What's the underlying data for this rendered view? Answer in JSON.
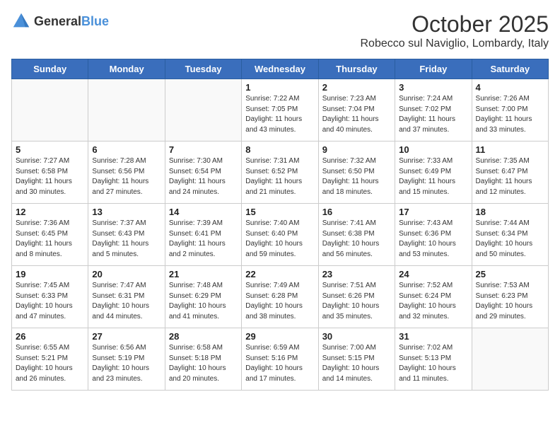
{
  "header": {
    "logo_general": "General",
    "logo_blue": "Blue",
    "month": "October 2025",
    "location": "Robecco sul Naviglio, Lombardy, Italy"
  },
  "days_of_week": [
    "Sunday",
    "Monday",
    "Tuesday",
    "Wednesday",
    "Thursday",
    "Friday",
    "Saturday"
  ],
  "weeks": [
    [
      {
        "day": "",
        "info": ""
      },
      {
        "day": "",
        "info": ""
      },
      {
        "day": "",
        "info": ""
      },
      {
        "day": "1",
        "info": "Sunrise: 7:22 AM\nSunset: 7:05 PM\nDaylight: 11 hours\nand 43 minutes."
      },
      {
        "day": "2",
        "info": "Sunrise: 7:23 AM\nSunset: 7:04 PM\nDaylight: 11 hours\nand 40 minutes."
      },
      {
        "day": "3",
        "info": "Sunrise: 7:24 AM\nSunset: 7:02 PM\nDaylight: 11 hours\nand 37 minutes."
      },
      {
        "day": "4",
        "info": "Sunrise: 7:26 AM\nSunset: 7:00 PM\nDaylight: 11 hours\nand 33 minutes."
      }
    ],
    [
      {
        "day": "5",
        "info": "Sunrise: 7:27 AM\nSunset: 6:58 PM\nDaylight: 11 hours\nand 30 minutes."
      },
      {
        "day": "6",
        "info": "Sunrise: 7:28 AM\nSunset: 6:56 PM\nDaylight: 11 hours\nand 27 minutes."
      },
      {
        "day": "7",
        "info": "Sunrise: 7:30 AM\nSunset: 6:54 PM\nDaylight: 11 hours\nand 24 minutes."
      },
      {
        "day": "8",
        "info": "Sunrise: 7:31 AM\nSunset: 6:52 PM\nDaylight: 11 hours\nand 21 minutes."
      },
      {
        "day": "9",
        "info": "Sunrise: 7:32 AM\nSunset: 6:50 PM\nDaylight: 11 hours\nand 18 minutes."
      },
      {
        "day": "10",
        "info": "Sunrise: 7:33 AM\nSunset: 6:49 PM\nDaylight: 11 hours\nand 15 minutes."
      },
      {
        "day": "11",
        "info": "Sunrise: 7:35 AM\nSunset: 6:47 PM\nDaylight: 11 hours\nand 12 minutes."
      }
    ],
    [
      {
        "day": "12",
        "info": "Sunrise: 7:36 AM\nSunset: 6:45 PM\nDaylight: 11 hours\nand 8 minutes."
      },
      {
        "day": "13",
        "info": "Sunrise: 7:37 AM\nSunset: 6:43 PM\nDaylight: 11 hours\nand 5 minutes."
      },
      {
        "day": "14",
        "info": "Sunrise: 7:39 AM\nSunset: 6:41 PM\nDaylight: 11 hours\nand 2 minutes."
      },
      {
        "day": "15",
        "info": "Sunrise: 7:40 AM\nSunset: 6:40 PM\nDaylight: 10 hours\nand 59 minutes."
      },
      {
        "day": "16",
        "info": "Sunrise: 7:41 AM\nSunset: 6:38 PM\nDaylight: 10 hours\nand 56 minutes."
      },
      {
        "day": "17",
        "info": "Sunrise: 7:43 AM\nSunset: 6:36 PM\nDaylight: 10 hours\nand 53 minutes."
      },
      {
        "day": "18",
        "info": "Sunrise: 7:44 AM\nSunset: 6:34 PM\nDaylight: 10 hours\nand 50 minutes."
      }
    ],
    [
      {
        "day": "19",
        "info": "Sunrise: 7:45 AM\nSunset: 6:33 PM\nDaylight: 10 hours\nand 47 minutes."
      },
      {
        "day": "20",
        "info": "Sunrise: 7:47 AM\nSunset: 6:31 PM\nDaylight: 10 hours\nand 44 minutes."
      },
      {
        "day": "21",
        "info": "Sunrise: 7:48 AM\nSunset: 6:29 PM\nDaylight: 10 hours\nand 41 minutes."
      },
      {
        "day": "22",
        "info": "Sunrise: 7:49 AM\nSunset: 6:28 PM\nDaylight: 10 hours\nand 38 minutes."
      },
      {
        "day": "23",
        "info": "Sunrise: 7:51 AM\nSunset: 6:26 PM\nDaylight: 10 hours\nand 35 minutes."
      },
      {
        "day": "24",
        "info": "Sunrise: 7:52 AM\nSunset: 6:24 PM\nDaylight: 10 hours\nand 32 minutes."
      },
      {
        "day": "25",
        "info": "Sunrise: 7:53 AM\nSunset: 6:23 PM\nDaylight: 10 hours\nand 29 minutes."
      }
    ],
    [
      {
        "day": "26",
        "info": "Sunrise: 6:55 AM\nSunset: 5:21 PM\nDaylight: 10 hours\nand 26 minutes."
      },
      {
        "day": "27",
        "info": "Sunrise: 6:56 AM\nSunset: 5:19 PM\nDaylight: 10 hours\nand 23 minutes."
      },
      {
        "day": "28",
        "info": "Sunrise: 6:58 AM\nSunset: 5:18 PM\nDaylight: 10 hours\nand 20 minutes."
      },
      {
        "day": "29",
        "info": "Sunrise: 6:59 AM\nSunset: 5:16 PM\nDaylight: 10 hours\nand 17 minutes."
      },
      {
        "day": "30",
        "info": "Sunrise: 7:00 AM\nSunset: 5:15 PM\nDaylight: 10 hours\nand 14 minutes."
      },
      {
        "day": "31",
        "info": "Sunrise: 7:02 AM\nSunset: 5:13 PM\nDaylight: 10 hours\nand 11 minutes."
      },
      {
        "day": "",
        "info": ""
      }
    ]
  ]
}
